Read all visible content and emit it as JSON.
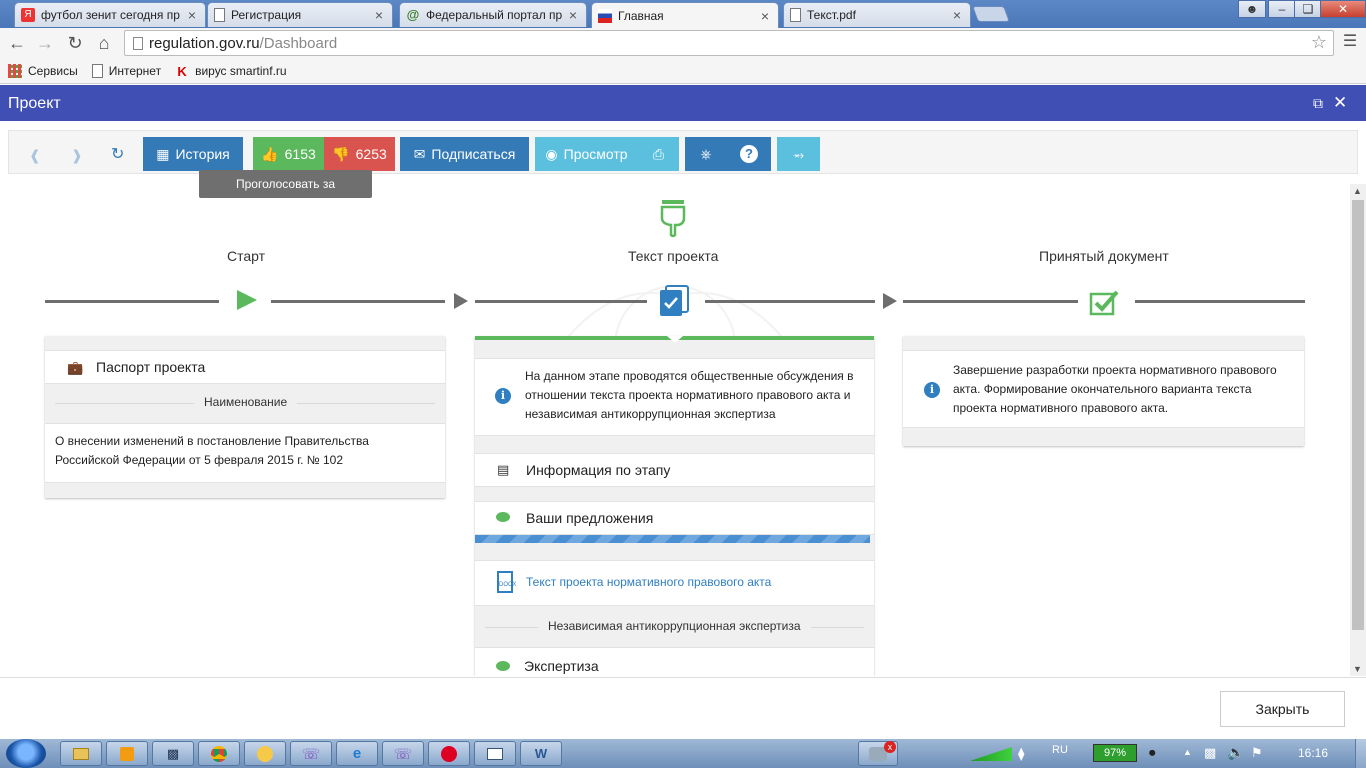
{
  "browser": {
    "tabs": [
      {
        "label": "футбол зенит сегодня пр",
        "favicon": "yandex-icon",
        "active": false
      },
      {
        "label": "Регистрация",
        "favicon": "page-icon",
        "active": false
      },
      {
        "label": "Федеральный портал пр",
        "favicon": "at-icon",
        "active": false
      },
      {
        "label": "Главная",
        "favicon": "regulation-icon",
        "active": true
      },
      {
        "label": "Текст.pdf",
        "favicon": "page-icon",
        "active": false
      }
    ],
    "address": {
      "host": "regulation.gov.ru",
      "path": "/Dashboard"
    },
    "bookmarks": [
      {
        "label": "Сервисы",
        "icon": "apps-grid-icon"
      },
      {
        "label": "Интернет",
        "icon": "page-icon"
      },
      {
        "label": "вирус smartinf.ru",
        "icon": "kaspersky-icon"
      }
    ]
  },
  "modal": {
    "title": "Проект"
  },
  "toolbar": {
    "history_label": "История",
    "likes": "6153",
    "dislikes": "6253",
    "subscribe_label": "Подписаться",
    "preview_label": "Просмотр",
    "tooltip": "Проголосовать за",
    "colors": {
      "primary": "#337ab7",
      "success": "#5cb85c",
      "danger": "#d9534f",
      "info": "#5bc0de"
    }
  },
  "stages": {
    "start": "Старт",
    "project_text": "Текст проекта",
    "accepted": "Принятый документ"
  },
  "left_panel": {
    "passport_label": "Паспорт проекта",
    "name_heading": "Наименование",
    "name_line1": "О внесении изменений в постановление Правительства",
    "name_line2": "Российской Федерации от 5 февраля 2015 г. № 102"
  },
  "middle_panel": {
    "info_line1": "На данном этапе проводятся общественные обсуждения в",
    "info_line2": "отношении текста проекта нормативного правового акта и",
    "info_line3": "независимая антикоррупционная экспертиза",
    "stage_info_label": "Информация по этапу",
    "proposals_label": "Ваши предложения",
    "doc_link": "Текст проекта нормативного правового акта",
    "anticorruption_heading": "Независимая антикоррупционная экспертиза",
    "expertise_label": "Экспертиза"
  },
  "right_panel": {
    "info_line1": "Завершение разработки проекта нормативного правового",
    "info_line2": "акта. Формирование окончательного варианта текста",
    "info_line3": "проекта нормативного правового акта."
  },
  "footer": {
    "close_label": "Закрыть"
  },
  "taskbar": {
    "lang": "RU",
    "battery": "97%",
    "time": "16:16"
  }
}
